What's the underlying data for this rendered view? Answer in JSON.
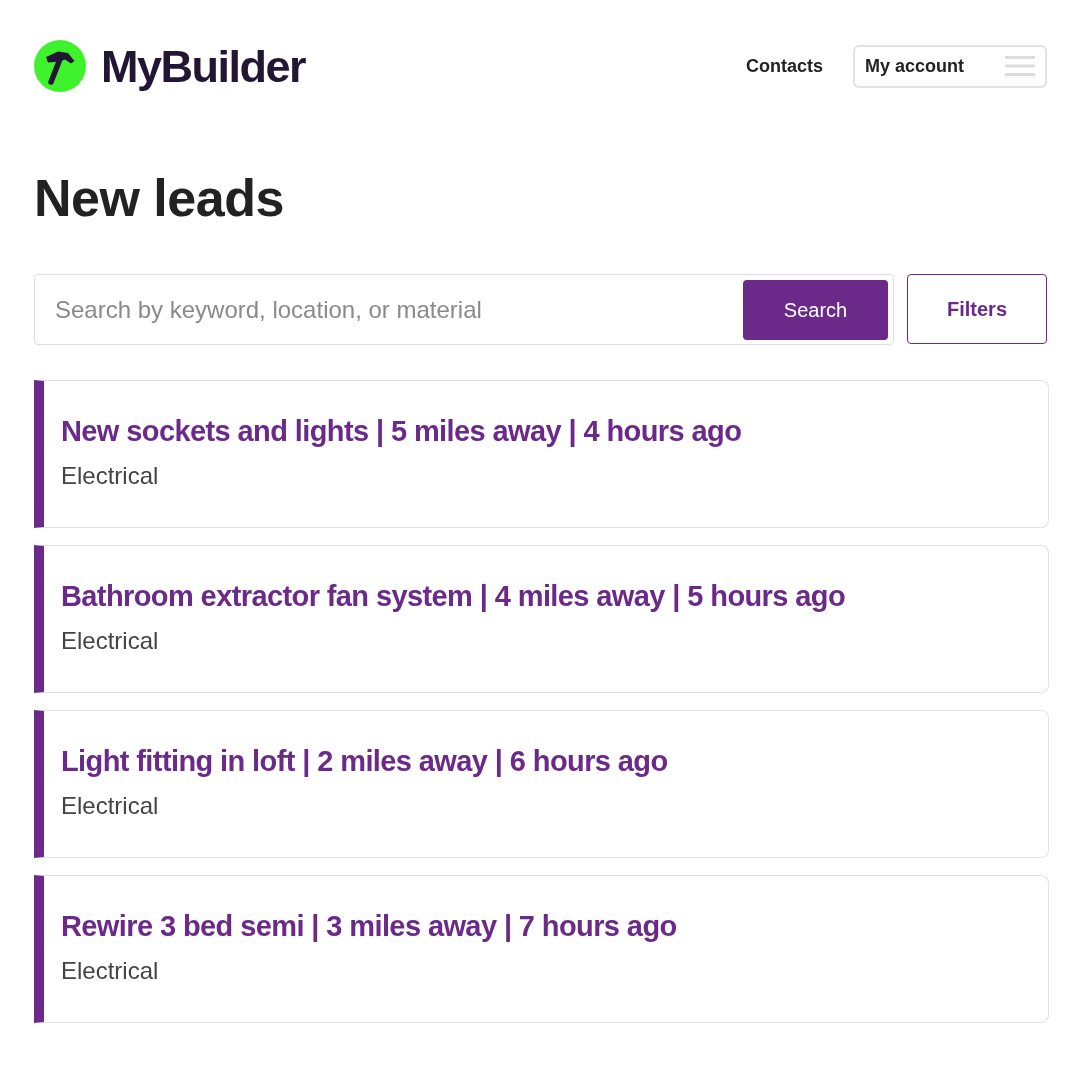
{
  "header": {
    "logo_text": "MyBuilder",
    "nav_link": "Contacts",
    "account_button": "My account"
  },
  "page_title": "New leads",
  "search": {
    "placeholder": "Search by keyword, location, or material",
    "button": "Search"
  },
  "filters_button": "Filters",
  "leads": [
    {
      "title": "New sockets and lights | 5 miles away | 4 hours ago",
      "category": "Electrical"
    },
    {
      "title": "Bathroom extractor fan system | 4 miles away | 5 hours ago",
      "category": "Electrical"
    },
    {
      "title": "Light fitting in loft | 2 miles away | 6 hours ago",
      "category": "Electrical"
    },
    {
      "title": "Rewire 3 bed semi | 3 miles away | 7 hours ago",
      "category": "Electrical"
    }
  ]
}
